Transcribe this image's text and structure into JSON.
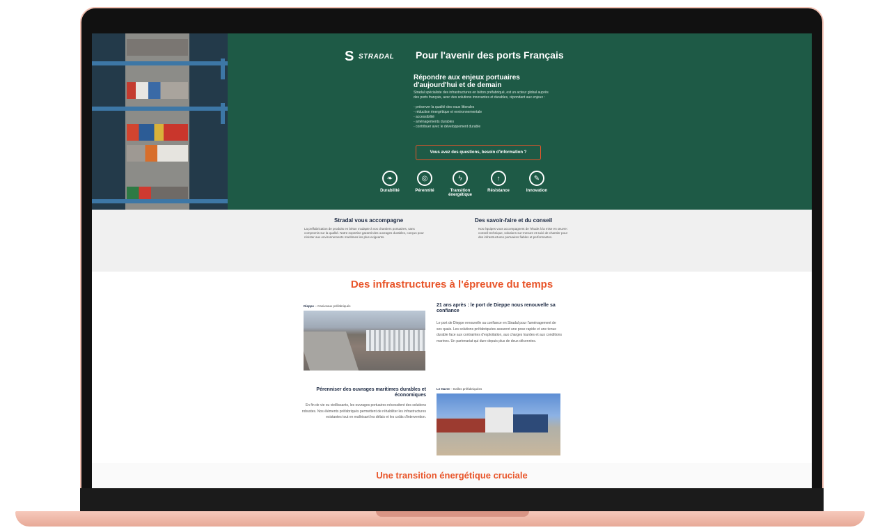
{
  "brand": {
    "logo_text": "STRADAL",
    "logo_mark": "S"
  },
  "hero": {
    "title": "Pour l'avenir des ports Français",
    "subtitle": "Répondre aux enjeux portuaires d'aujourd'hui et de demain",
    "intro": "Stradal spécialiste des infrastructures en béton préfabriqué, est un acteur global auprès des ports français, avec des solutions innovantes et durables, répondant aux enjeux :",
    "bullets": [
      "- préserver la qualité des eaux littorales",
      "- réduction énergétique et environnementale",
      "- accessibilité",
      "- aménagements durables",
      "- contribuer avec le développement durable"
    ],
    "cta": "Vous avez des questions, besoin d'information ?",
    "icons": [
      {
        "label": "Durabilité",
        "icon": "leaf-icon"
      },
      {
        "label": "Pérennité",
        "icon": "globe-icon"
      },
      {
        "label": "Transition énergétique",
        "icon": "lightning-icon"
      },
      {
        "label": "Résistance",
        "icon": "shield-icon"
      },
      {
        "label": "Innovation",
        "icon": "tools-icon"
      }
    ]
  },
  "grey": {
    "col1_title": "Stradal vous accompagne",
    "col1_text": "La préfabrication de produits en béton s'adapte à vos chantiers portuaires, sans compromis sur la qualité. Notre expertise garantit des ouvrages durables, conçus pour résister aux environnements maritimes les plus exigeants.",
    "col2_title": "Des savoir-faire et du conseil",
    "col2_text": "Nos équipes vous accompagnent de l'étude à la mise en œuvre : conseil technique, solutions sur-mesure et suivi de chantier pour des infrastructures portuaires fiables et performantes."
  },
  "section1": {
    "title": "Des infrastructures à l'épreuve du temps",
    "caption1_bold": "Dieppe",
    "caption1_rest": " – Caniveaux préfabriqués",
    "article1_title": "21 ans après : le port de Dieppe nous renouvelle sa confiance",
    "article1_text": "Le port de Dieppe renouvelle sa confiance en Stradal pour l'aménagement de ses quais. Les solutions préfabriquées assurent une pose rapide et une tenue durable face aux contraintes d'exploitation, aux charges lourdes et aux conditions marines. Un partenariat qui dure depuis plus de deux décennies.",
    "article2_title": "Pérenniser des ouvrages maritimes durables et économiques",
    "article2_text": "En fin de vie ou vieillissants, les ouvrages portuaires nécessitent des solutions robustes. Nos éléments préfabriqués permettent de réhabiliter les infrastructures existantes tout en maîtrisant les délais et les coûts d'intervention.",
    "caption2_bold": "Le Havre",
    "caption2_rest": " – Dalles préfabriquées"
  },
  "section2": {
    "title": "Une transition énergétique cruciale"
  },
  "colors": {
    "hero_bg": "#1e5a46",
    "accent": "#e8552a",
    "navy": "#1a2740",
    "grey_band": "#f0f0f0"
  }
}
